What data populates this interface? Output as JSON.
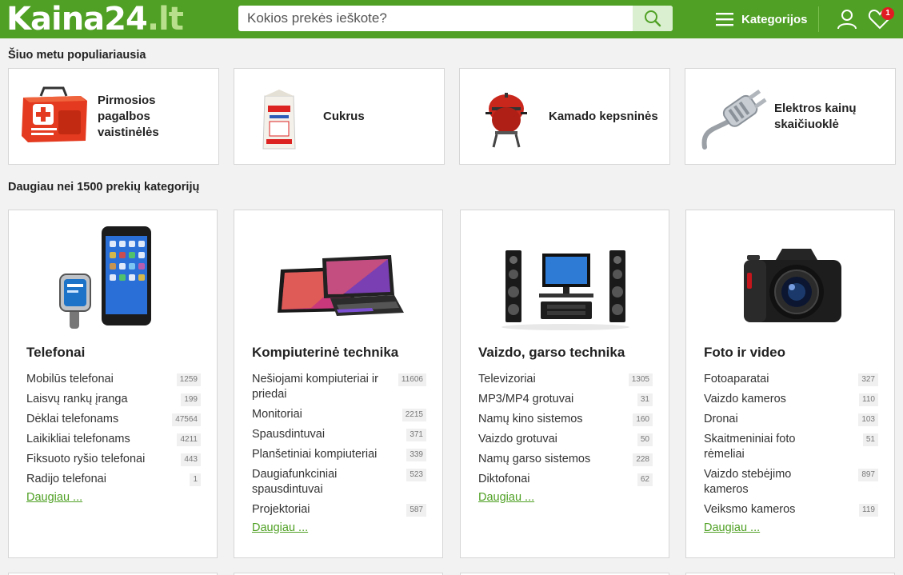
{
  "header": {
    "logo_main": "Kaina24",
    "logo_tld": ".lt",
    "search_placeholder": "Kokios prekės ieškote?",
    "menu_label": "Kategorijos",
    "wishlist_count": "1",
    "icons": [
      "search-icon",
      "menu-icon",
      "user-icon",
      "heart-icon"
    ]
  },
  "popular": {
    "title": "Šiuo metu populiariausia",
    "items": [
      {
        "label": "Pirmosios pagalbos vaistinėlės",
        "icon": "first-aid-kit-icon"
      },
      {
        "label": "Cukrus",
        "icon": "sugar-bag-icon"
      },
      {
        "label": "Kamado kepsninės",
        "icon": "kamado-grill-icon"
      },
      {
        "label": "Elektros kainų skaičiuoklė",
        "icon": "electric-plug-icon"
      }
    ]
  },
  "categories": {
    "title": "Daugiau nei 1500 prekių kategorijų",
    "more_label": "Daugiau ...",
    "cards": [
      {
        "title": "Telefonai",
        "icon": "phone-watch-icon",
        "items": [
          {
            "name": "Mobilūs telefonai",
            "count": "1259"
          },
          {
            "name": "Laisvų rankų įranga",
            "count": "199"
          },
          {
            "name": "Dėklai telefonams",
            "count": "47564"
          },
          {
            "name": "Laikikliai telefonams",
            "count": "4211"
          },
          {
            "name": "Fiksuoto ryšio telefonai",
            "count": "443"
          },
          {
            "name": "Radijo telefonai",
            "count": "1"
          }
        ]
      },
      {
        "title": "Kompiuterinė technika",
        "icon": "laptop-tablet-icon",
        "items": [
          {
            "name": "Nešiojami kompiuteriai ir priedai",
            "count": "11606"
          },
          {
            "name": "Monitoriai",
            "count": "2215"
          },
          {
            "name": "Spausdintuvai",
            "count": "371"
          },
          {
            "name": "Planšetiniai kompiuteriai",
            "count": "339"
          },
          {
            "name": "Daugiafunkciniai spausdintuvai",
            "count": "523"
          },
          {
            "name": "Projektoriai",
            "count": "587"
          }
        ]
      },
      {
        "title": "Vaizdo, garso technika",
        "icon": "home-theater-icon",
        "items": [
          {
            "name": "Televizoriai",
            "count": "1305"
          },
          {
            "name": "MP3/MP4 grotuvai",
            "count": "31"
          },
          {
            "name": "Namų kino sistemos",
            "count": "160"
          },
          {
            "name": "Vaizdo grotuvai",
            "count": "50"
          },
          {
            "name": "Namų garso sistemos",
            "count": "228"
          },
          {
            "name": "Diktofonai",
            "count": "62"
          }
        ]
      },
      {
        "title": "Foto ir video",
        "icon": "camera-icon",
        "items": [
          {
            "name": "Fotoaparatai",
            "count": "327"
          },
          {
            "name": "Vaizdo kameros",
            "count": "110"
          },
          {
            "name": "Dronai",
            "count": "103"
          },
          {
            "name": "Skaitmeniniai foto rėmeliai",
            "count": "51"
          },
          {
            "name": "Vaizdo stebėjimo kameros",
            "count": "897"
          },
          {
            "name": "Veiksmo kameros",
            "count": "119"
          }
        ]
      }
    ]
  },
  "colors": {
    "brand": "#4fa024",
    "badge": "#e11b22",
    "link": "#4fa024"
  }
}
